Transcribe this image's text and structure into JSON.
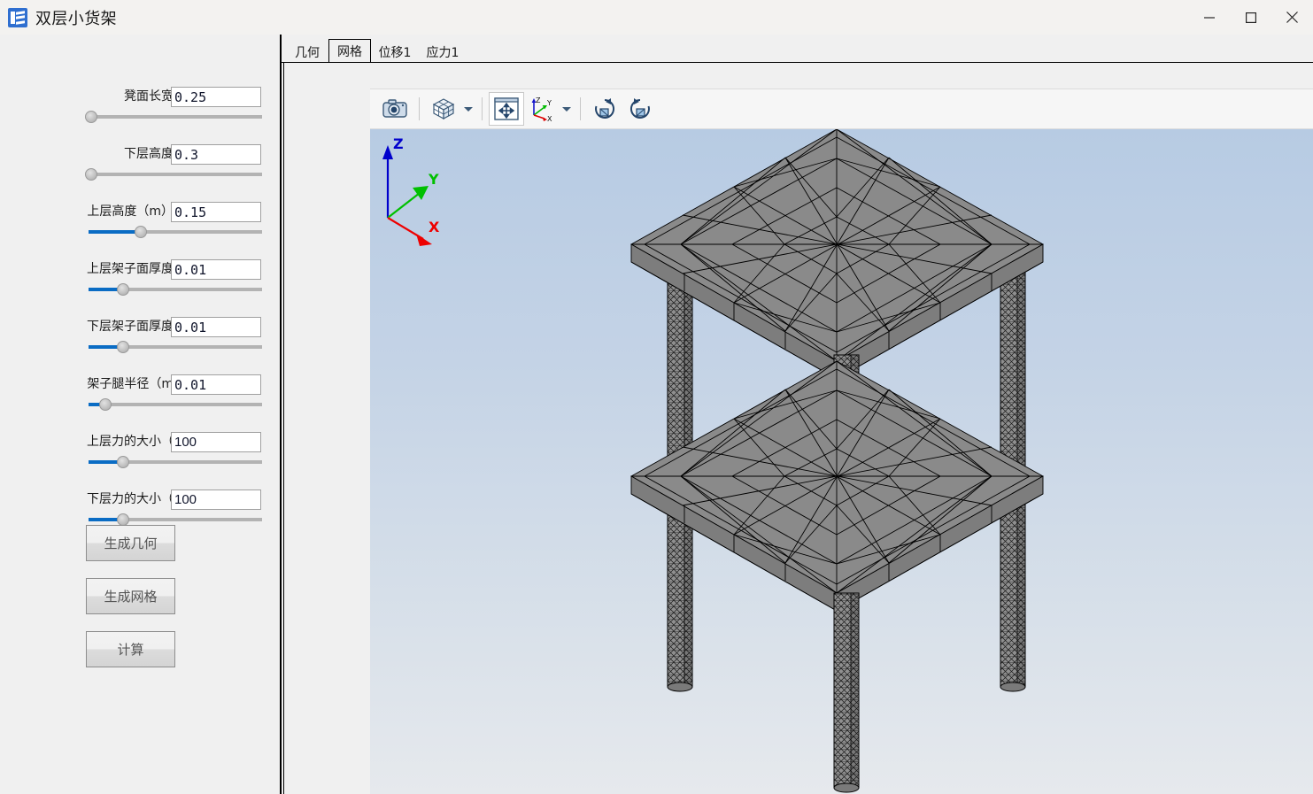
{
  "window": {
    "title": "双层小货架",
    "icon": "layers-icon",
    "controls": {
      "minimize": "minimize-icon",
      "maximize": "maximize-icon",
      "close": "close-icon"
    }
  },
  "tabs": [
    {
      "label": "几何",
      "active": false
    },
    {
      "label": "网格",
      "active": true
    },
    {
      "label": "位移1",
      "active": false
    },
    {
      "label": "应力1",
      "active": false
    }
  ],
  "controls": [
    {
      "label": "凳面长宽",
      "value": "0.25",
      "monospace": true,
      "fill_pct": 0
    },
    {
      "label": "下层高度",
      "value": "0.3",
      "monospace": true,
      "fill_pct": 0
    },
    {
      "label": "上层高度（m）",
      "value": "0.15",
      "monospace": true,
      "fill_pct": 30
    },
    {
      "label": "上层架子面厚度",
      "value": "0.01",
      "monospace": true,
      "fill_pct": 20
    },
    {
      "label": "下层架子面厚度",
      "value": "0.01",
      "monospace": true,
      "fill_pct": 20
    },
    {
      "label": "架子腿半径（m",
      "value": "0.01",
      "monospace": true,
      "fill_pct": 10
    },
    {
      "label": "上层力的大小（",
      "value": "100",
      "monospace": false,
      "fill_pct": 20
    },
    {
      "label": "下层力的大小（",
      "value": "100",
      "monospace": false,
      "fill_pct": 20
    }
  ],
  "buttons": [
    {
      "label": "生成几何"
    },
    {
      "label": "生成网格"
    },
    {
      "label": "计算"
    }
  ],
  "viewer_toolbar": [
    {
      "name": "screenshot-camera-button",
      "icon": "camera-icon",
      "caret": false
    },
    {
      "name": "view-style-button",
      "icon": "view-cube-icon",
      "caret": true
    },
    {
      "name": "fit-to-view-button",
      "icon": "fit-screen-icon",
      "caret": false
    },
    {
      "name": "view-orientation-button",
      "icon": "axis-triad-icon",
      "caret": true
    },
    {
      "name": "rotate-cw-button",
      "icon": "rotate-cw-icon",
      "caret": false
    },
    {
      "name": "rotate-ccw-button",
      "icon": "rotate-ccw-icon",
      "caret": false
    }
  ],
  "viewport": {
    "axis_labels": {
      "x": "X",
      "y": "Y",
      "z": "Z"
    },
    "axis_colors": {
      "x": "#ee0000",
      "y": "#00c000",
      "z": "#0000cc"
    },
    "model": "两层货架三角形有限元网格",
    "mesh_fill": "#8a8a8a",
    "mesh_edge": "#000000",
    "background_top": "#b7cbe3",
    "background_bottom": "#e6e9ed"
  }
}
